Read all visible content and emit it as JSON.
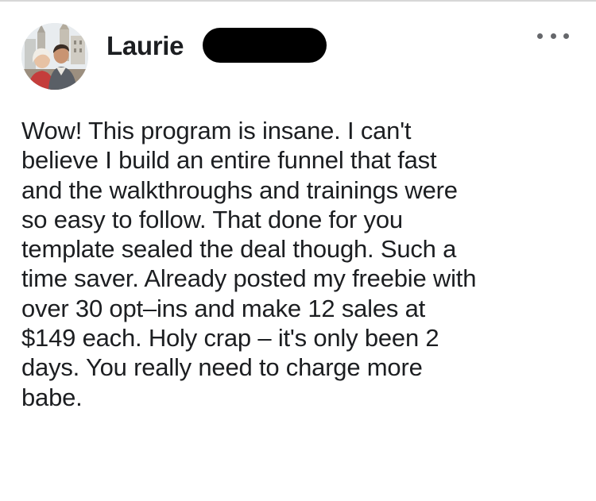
{
  "post": {
    "author": {
      "name": "Laurie",
      "avatar_icon": "profile-photo",
      "name_redacted": true
    },
    "menu_icon": "more-options-icon",
    "text": "Wow! This program is insane. I can't\nbelieve I build an entire funnel that fast\nand the walkthroughs and trainings were\nso easy to follow. That done for you\ntemplate sealed the deal though. Such a\ntime saver. Already posted my freebie with\nover 30 opt–ins and make 12 sales at\n$149 each.  Holy crap – it's only been 2\ndays.  You really need to charge more\nbabe."
  },
  "colors": {
    "text": "#1c1e21",
    "secondary": "#65676b",
    "redaction": "#000000",
    "background": "#ffffff"
  }
}
